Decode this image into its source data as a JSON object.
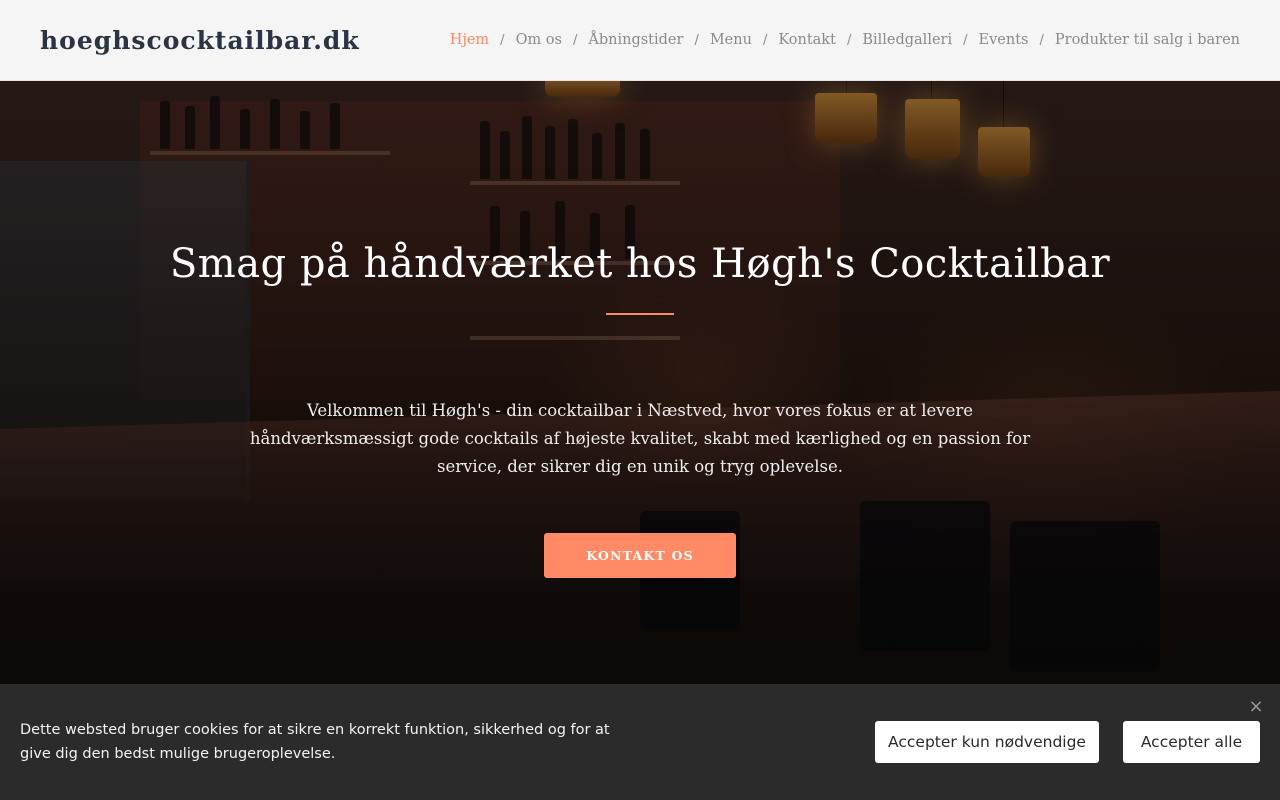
{
  "header": {
    "logo": "hoeghscocktailbar.dk",
    "nav": [
      {
        "label": "Hjem",
        "active": true
      },
      {
        "label": "Om os",
        "active": false
      },
      {
        "label": "Åbningstider",
        "active": false
      },
      {
        "label": "Menu",
        "active": false
      },
      {
        "label": "Kontakt",
        "active": false
      },
      {
        "label": "Billedgalleri",
        "active": false
      },
      {
        "label": "Events",
        "active": false
      },
      {
        "label": "Produkter til salg i baren",
        "active": false
      }
    ],
    "separator": "/"
  },
  "hero": {
    "title": "Smag på håndværket hos Høgh's Cocktailbar",
    "text": "Velkommen til Høgh's - din cocktailbar i Næstved, hvor vores fokus er at levere håndværksmæssigt gode cocktails af højeste kvalitet, skabt med kærlighed og en passion for service, der sikrer dig en unik og tryg oplevelse.",
    "button_label": "KONTAKT OS"
  },
  "cookie_bar": {
    "text": "Dette websted bruger cookies for at sikre en korrekt funktion, sikkerhed og for at give dig den bedst mulige brugeroplevelse.",
    "necessary_label": "Accepter kun nødvendige",
    "all_label": "Accepter alle",
    "close_icon": "close-icon"
  },
  "colors": {
    "accent": "#ff8a65",
    "logo": "#2b3444",
    "nav": "#8a8a8a",
    "cookie_bg": "#2b2b2b"
  }
}
